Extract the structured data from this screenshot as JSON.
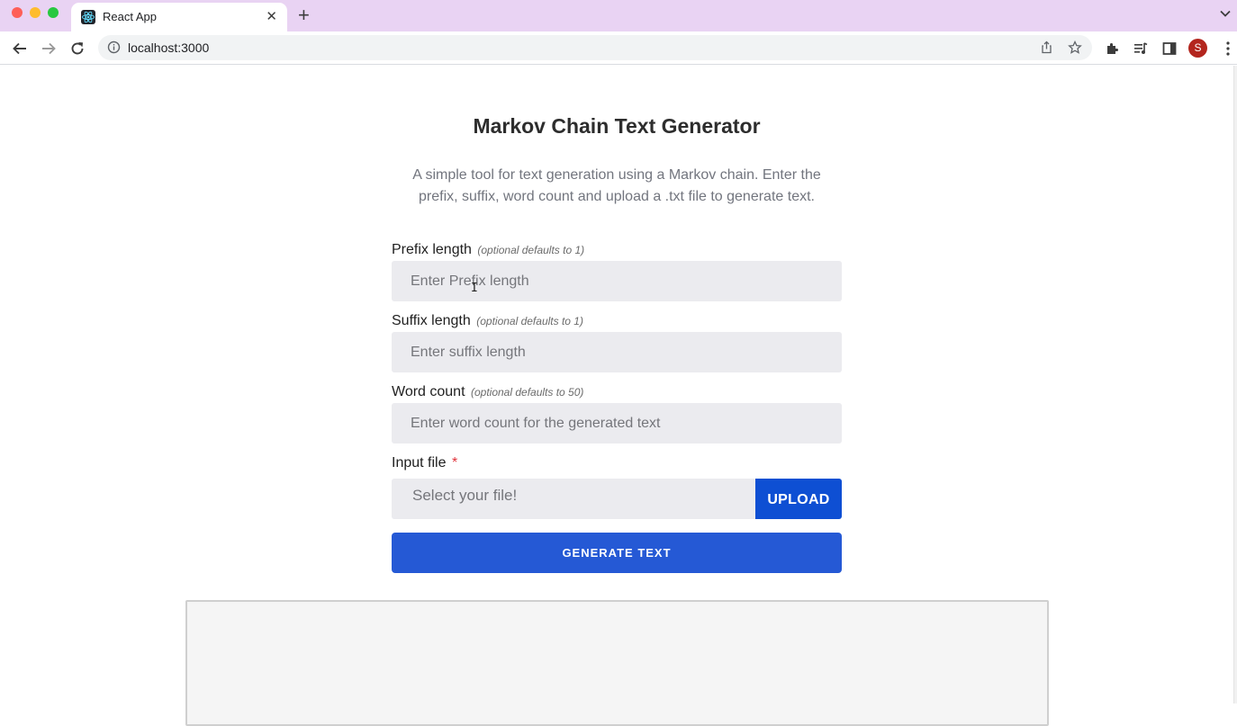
{
  "browser": {
    "tab_title": "React App",
    "tab_close_symbol": "✕",
    "new_tab_symbol": "+",
    "url": "localhost:3000",
    "profile_initial": "S"
  },
  "app": {
    "title": "Markov Chain Text Generator",
    "subtitle": "A simple tool for text generation using a Markov chain. Enter the prefix, suffix, word count and upload a .txt file to generate text.",
    "prefix": {
      "label": "Prefix length",
      "hint": "(optional defaults to 1)",
      "placeholder": "Enter Prefix length",
      "value": ""
    },
    "suffix": {
      "label": "Suffix length",
      "hint": "(optional defaults to 1)",
      "placeholder": "Enter suffix length",
      "value": ""
    },
    "word_count": {
      "label": "Word count",
      "hint": "(optional defaults to 50)",
      "placeholder": "Enter word count for the generated text",
      "value": ""
    },
    "input_file": {
      "label": "Input file",
      "required_marker": "*",
      "placeholder": "Select your file!",
      "upload_label": "UPLOAD"
    },
    "generate_label": "GENERATE TEXT",
    "output_text": ""
  },
  "colors": {
    "tabbar": "#e9d3f3",
    "upload_button": "#0e4fd3",
    "generate_button": "#2559d5",
    "input_bg": "#ebebef",
    "required": "#e0323a"
  },
  "icons": [
    "react-logo-icon",
    "close-icon",
    "plus-icon",
    "chevron-down-icon",
    "back-arrow-icon",
    "forward-arrow-icon",
    "reload-icon",
    "info-icon",
    "share-icon",
    "star-icon",
    "extensions-icon",
    "media-icon",
    "side-panel-icon",
    "kebab-menu-icon",
    "text-cursor-icon"
  ]
}
